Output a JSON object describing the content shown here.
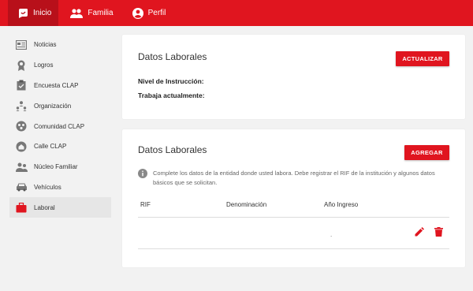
{
  "nav": {
    "items": [
      {
        "label": "Inicio",
        "icon": "app-logo-icon"
      },
      {
        "label": "Familia",
        "icon": "people-icon"
      },
      {
        "label": "Perfil",
        "icon": "account-circle-icon"
      }
    ]
  },
  "sidebar": {
    "items": [
      {
        "label": "Noticias",
        "icon": "news-icon"
      },
      {
        "label": "Logros",
        "icon": "award-icon"
      },
      {
        "label": "Encuesta CLAP",
        "icon": "clipboard-icon"
      },
      {
        "label": "Organización",
        "icon": "hierarchy-icon"
      },
      {
        "label": "Comunidad CLAP",
        "icon": "community-icon"
      },
      {
        "label": "Calle CLAP",
        "icon": "map-icon"
      },
      {
        "label": "Núcleo Familiar",
        "icon": "family-icon"
      },
      {
        "label": "Vehículos",
        "icon": "car-icon"
      },
      {
        "label": "Laboral",
        "icon": "briefcase-icon",
        "active": true
      }
    ]
  },
  "card1": {
    "title": "Datos Laborales",
    "button": "ACTUALIZAR",
    "fields": {
      "instruccion_label": "Nivel de Instrucción:",
      "trabaja_label": "Trabaja actualmente:"
    }
  },
  "card2": {
    "title": "Datos Laborales",
    "button": "AGREGAR",
    "info": "Complete los datos de la entidad donde usted labora. Debe registrar el RIF de la institución y algunos datos básicos que se solicitan.",
    "columns": [
      "RIF",
      "Denominación",
      "Año Ingreso"
    ],
    "row": {
      "anio": "."
    }
  },
  "colors": {
    "accent": "#e0151f",
    "accent_dark": "#b8101a"
  }
}
